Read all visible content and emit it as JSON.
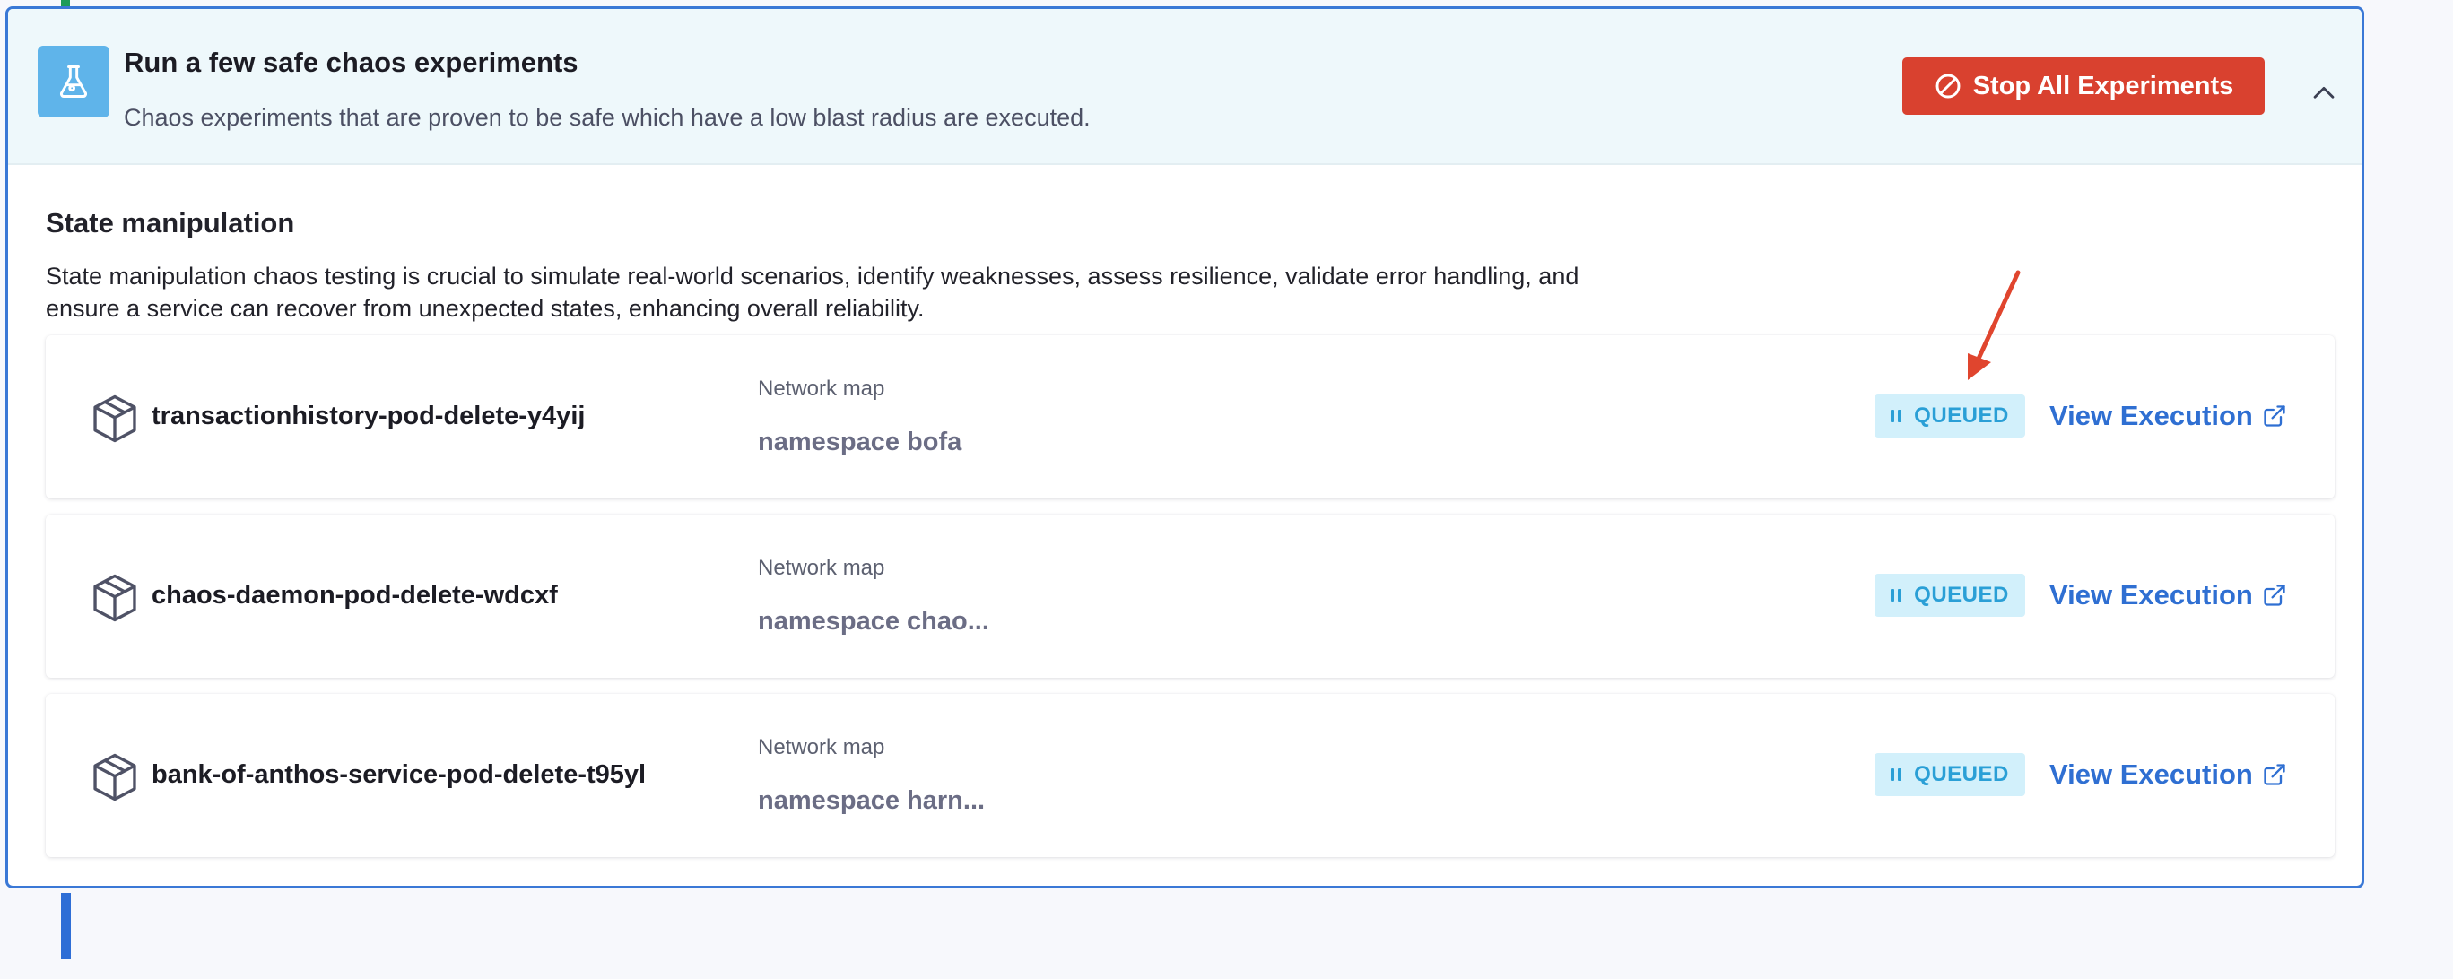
{
  "header": {
    "icon": "flask-icon",
    "title": "Run a few safe chaos experiments",
    "subtitle": "Chaos experiments that are proven to be safe which have a low blast radius are executed.",
    "stop_button": {
      "label": "Stop All Experiments",
      "icon": "ban-icon"
    },
    "collapse_icon": "chevron-up-icon"
  },
  "section": {
    "title": "State manipulation",
    "description": "State manipulation chaos testing is crucial to simulate real-world scenarios, identify weaknesses, assess resilience, validate error handling, and ensure a service can recover from unexpected states, enhancing overall reliability."
  },
  "experiments": [
    {
      "icon": "package-box-icon",
      "name": "transactionhistory-pod-delete-y4yij",
      "map_label": "Network map",
      "map_value": "namespace bofa",
      "status": "QUEUED",
      "link_label": "View Execution",
      "link_icon": "external-link-icon"
    },
    {
      "icon": "package-box-icon",
      "name": "chaos-daemon-pod-delete-wdcxf",
      "map_label": "Network map",
      "map_value": "namespace chao...",
      "status": "QUEUED",
      "link_label": "View Execution",
      "link_icon": "external-link-icon"
    },
    {
      "icon": "package-box-icon",
      "name": "bank-of-anthos-service-pod-delete-t95yl",
      "map_label": "Network map",
      "map_value": "namespace harn...",
      "status": "QUEUED",
      "link_label": "View Execution",
      "link_icon": "external-link-icon"
    }
  ],
  "annotation": {
    "icon": "red-arrow-annotation",
    "color": "#e0452e"
  },
  "colors": {
    "accent": "#2f6fd2",
    "danger": "#d9412f",
    "queued": "#2a9fd6",
    "header_bg": "#eef8fb"
  }
}
